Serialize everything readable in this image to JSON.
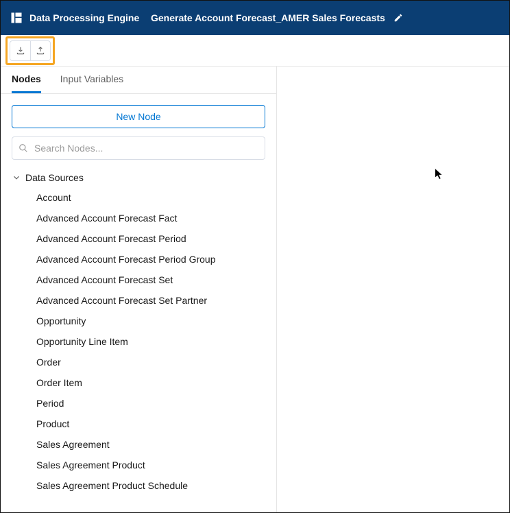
{
  "header": {
    "app_title": "Data Processing Engine",
    "definition_title": "Generate Account Forecast_AMER Sales Forecasts"
  },
  "tabs": {
    "nodes": "Nodes",
    "input_vars": "Input Variables"
  },
  "panel": {
    "new_node_label": "New Node",
    "search_placeholder": "Search Nodes..."
  },
  "tree": {
    "group_label": "Data Sources",
    "items": [
      "Account",
      "Advanced Account Forecast Fact",
      "Advanced Account Forecast Period",
      "Advanced Account Forecast Period Group",
      "Advanced Account Forecast Set",
      "Advanced Account Forecast Set Partner",
      "Opportunity",
      "Opportunity Line Item",
      "Order",
      "Order Item",
      "Period",
      "Product",
      "Sales Agreement",
      "Sales Agreement Product",
      "Sales Agreement Product Schedule"
    ]
  }
}
